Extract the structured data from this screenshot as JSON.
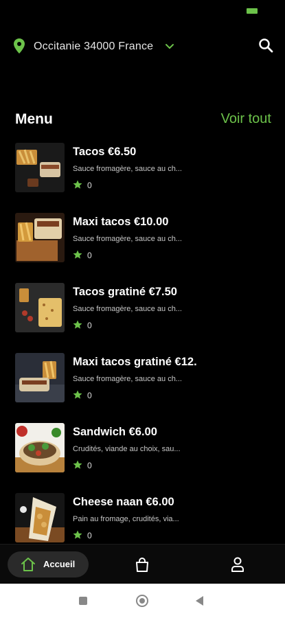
{
  "header": {
    "location": "Occitanie 34000 France",
    "location_icon": "map-pin-icon",
    "chevron_icon": "chevron-down-icon",
    "search_icon": "search-icon"
  },
  "section": {
    "title": "Menu",
    "see_all": "Voir tout"
  },
  "menu": [
    {
      "title": "Tacos €6.50",
      "description": "Sauce fromagère, sauce au ch...",
      "rating": "0"
    },
    {
      "title": "Maxi tacos €10.00",
      "description": "Sauce fromagère, sauce au ch...",
      "rating": "0"
    },
    {
      "title": "Tacos gratiné €7.50",
      "description": "Sauce fromagère, sauce au ch...",
      "rating": "0"
    },
    {
      "title": "Maxi tacos gratiné €12.",
      "description": "Sauce fromagère, sauce au ch...",
      "rating": "0"
    },
    {
      "title": "Sandwich €6.00",
      "description": "Crudités, viande au choix, sau...",
      "rating": "0"
    },
    {
      "title": "Cheese naan €6.00",
      "description": "Pain au fromage, crudités, via...",
      "rating": "0"
    }
  ],
  "bottom_nav": {
    "home_label": "Accueil",
    "home_icon": "home-icon",
    "bag_icon": "shopping-bag-icon",
    "user_icon": "user-icon"
  },
  "colors": {
    "accent": "#6cc24a",
    "background": "#000000"
  }
}
